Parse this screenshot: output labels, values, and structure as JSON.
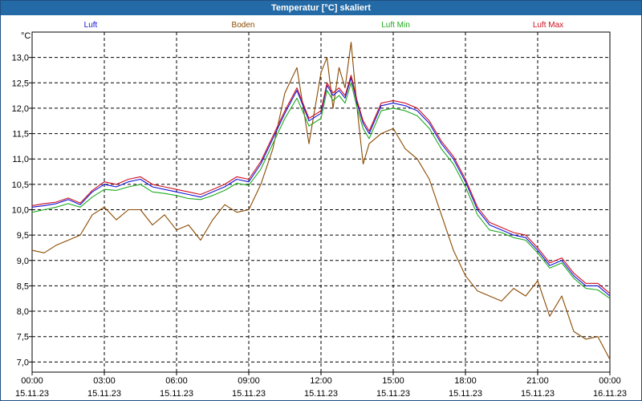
{
  "window": {
    "title": "Temperatur [°C] skaliert"
  },
  "colors": {
    "Luft": "#1414d8",
    "Boden": "#8a4a00",
    "Luft Min": "#1faa1f",
    "Luft Max": "#cc1020",
    "grid": "#000000"
  },
  "chart_data": {
    "type": "line",
    "title": "Temperatur [°C] skaliert",
    "ylabel": "°C",
    "xlabel": "",
    "ylim": [
      6.8,
      13.5
    ],
    "xlim": [
      "15.11.23 00:00",
      "16.11.23 00:00"
    ],
    "grid": true,
    "legend": "top",
    "yticks": [
      "7,0",
      "7,5",
      "8,0",
      "8,5",
      "9,0",
      "9,5",
      "10,0",
      "10,5",
      "11,0",
      "11,5",
      "12,0",
      "12,5",
      "13,0"
    ],
    "ytick_values": [
      7.0,
      7.5,
      8.0,
      8.5,
      9.0,
      9.5,
      10.0,
      10.5,
      11.0,
      11.5,
      12.0,
      12.5,
      13.0
    ],
    "xticks": [
      {
        "time": "00:00",
        "date": "15.11.23"
      },
      {
        "time": "03:00",
        "date": "15.11.23"
      },
      {
        "time": "06:00",
        "date": "15.11.23"
      },
      {
        "time": "09:00",
        "date": "15.11.23"
      },
      {
        "time": "12:00",
        "date": "15.11.23"
      },
      {
        "time": "15:00",
        "date": "15.11.23"
      },
      {
        "time": "18:00",
        "date": "15.11.23"
      },
      {
        "time": "21:00",
        "date": "15.11.23"
      },
      {
        "time": "00:00",
        "date": "16.11.23"
      }
    ],
    "x_hours": [
      0,
      0.5,
      1,
      1.5,
      2,
      2.5,
      3,
      3.5,
      4,
      4.5,
      5,
      5.5,
      6,
      6.5,
      7,
      7.5,
      8,
      8.5,
      9,
      9.5,
      10,
      10.5,
      11,
      11.5,
      12,
      12.25,
      12.5,
      12.75,
      13,
      13.25,
      13.5,
      13.75,
      14,
      14.5,
      15,
      15.5,
      16,
      16.5,
      17,
      17.5,
      18,
      18.5,
      19,
      19.5,
      20,
      20.5,
      21,
      21.5,
      22,
      22.5,
      23,
      23.5,
      24
    ],
    "series": [
      {
        "name": "Luft",
        "values": [
          10.05,
          10.08,
          10.12,
          10.2,
          10.1,
          10.35,
          10.5,
          10.45,
          10.55,
          10.6,
          10.45,
          10.4,
          10.35,
          10.3,
          10.25,
          10.35,
          10.45,
          10.6,
          10.55,
          10.9,
          11.4,
          11.9,
          12.35,
          11.75,
          11.9,
          12.45,
          12.25,
          12.35,
          12.2,
          12.6,
          12.1,
          11.7,
          11.5,
          12.05,
          12.1,
          12.05,
          11.95,
          11.7,
          11.3,
          11.0,
          10.55,
          10.0,
          9.7,
          9.6,
          9.5,
          9.45,
          9.2,
          8.9,
          9.0,
          8.7,
          8.5,
          8.5,
          8.3
        ]
      },
      {
        "name": "Luft Min",
        "values": [
          9.95,
          10.0,
          10.05,
          10.12,
          10.05,
          10.25,
          10.4,
          10.38,
          10.45,
          10.5,
          10.35,
          10.32,
          10.28,
          10.22,
          10.2,
          10.28,
          10.38,
          10.52,
          10.48,
          10.8,
          11.3,
          11.8,
          12.2,
          11.65,
          11.8,
          12.35,
          12.15,
          12.25,
          12.1,
          12.5,
          12.0,
          11.6,
          11.4,
          11.95,
          12.0,
          11.95,
          11.85,
          11.6,
          11.2,
          10.9,
          10.45,
          9.9,
          9.6,
          9.55,
          9.45,
          9.4,
          9.15,
          8.85,
          8.95,
          8.65,
          8.45,
          8.42,
          8.25
        ]
      },
      {
        "name": "Luft Max",
        "values": [
          10.08,
          10.12,
          10.15,
          10.23,
          10.13,
          10.38,
          10.55,
          10.5,
          10.6,
          10.65,
          10.5,
          10.45,
          10.4,
          10.35,
          10.3,
          10.4,
          10.5,
          10.65,
          10.6,
          10.95,
          11.45,
          11.95,
          12.4,
          11.8,
          11.95,
          12.5,
          12.3,
          12.4,
          12.25,
          12.65,
          12.15,
          11.75,
          11.55,
          12.1,
          12.15,
          12.1,
          12.0,
          11.75,
          11.35,
          11.05,
          10.6,
          10.05,
          9.75,
          9.65,
          9.55,
          9.5,
          9.25,
          8.95,
          9.05,
          8.75,
          8.55,
          8.55,
          8.35
        ]
      },
      {
        "name": "Boden",
        "values": [
          9.2,
          9.15,
          9.3,
          9.4,
          9.5,
          9.9,
          10.05,
          9.8,
          10.0,
          10.0,
          9.7,
          9.9,
          9.6,
          9.7,
          9.4,
          9.8,
          10.1,
          9.95,
          10.0,
          10.5,
          11.2,
          12.3,
          12.8,
          11.3,
          12.7,
          13.0,
          12.0,
          12.8,
          12.4,
          13.3,
          12.0,
          10.9,
          11.3,
          11.5,
          11.6,
          11.2,
          11.0,
          10.6,
          9.9,
          9.2,
          8.7,
          8.4,
          8.3,
          8.2,
          8.45,
          8.3,
          8.6,
          7.9,
          8.3,
          7.6,
          7.45,
          7.5,
          7.05
        ]
      }
    ]
  }
}
